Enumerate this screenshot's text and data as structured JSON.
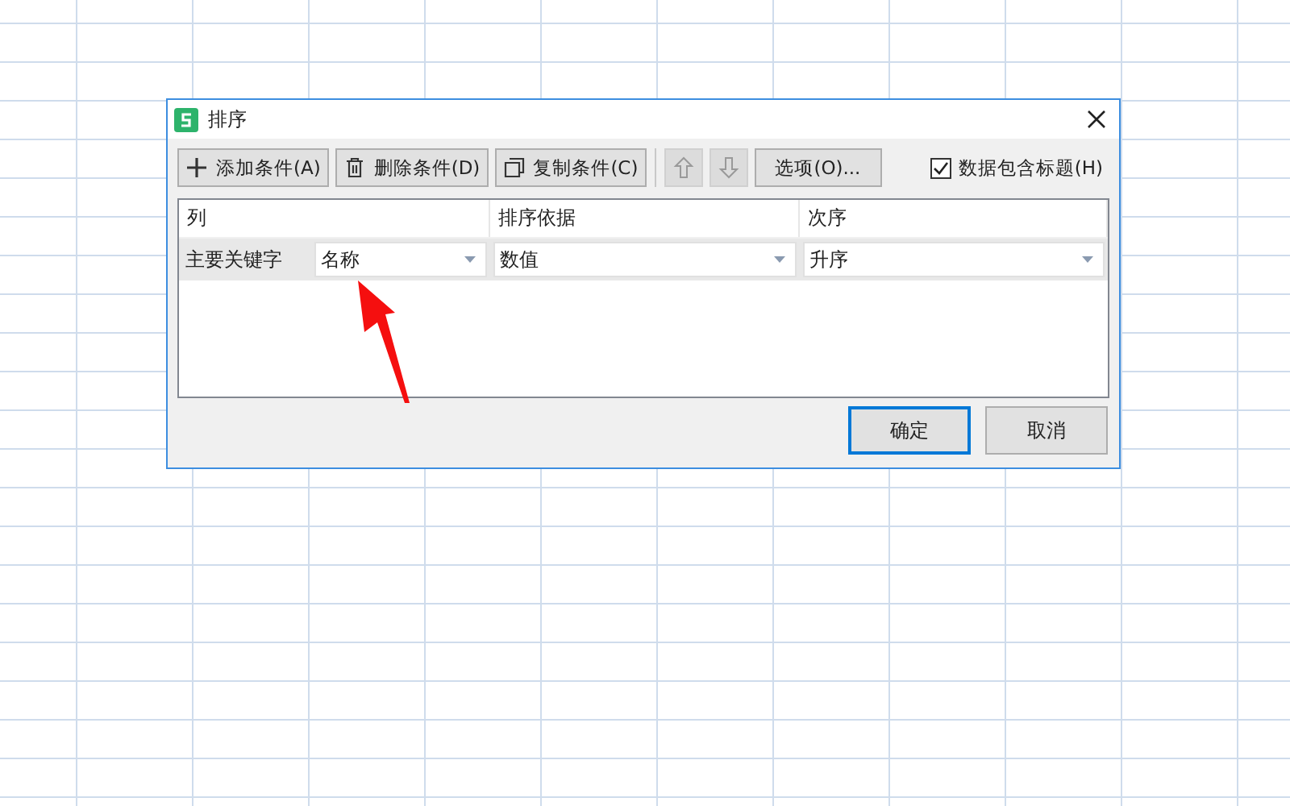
{
  "window": {
    "title": "排序"
  },
  "toolbar": {
    "buttons": [
      {
        "kind": "add",
        "label": "添加条件(A)",
        "disabled": false
      },
      {
        "kind": "delete",
        "label": "删除条件(D)",
        "disabled": false
      },
      {
        "kind": "copy",
        "label": "复制条件(C)",
        "disabled": false
      },
      {
        "kind": "up",
        "disabled": true
      },
      {
        "kind": "down",
        "disabled": true
      },
      {
        "kind": "text",
        "label": "选项(O)...",
        "disabled": false
      }
    ],
    "checkbox": {
      "label": "数据包含标题(H)",
      "checked": true
    }
  },
  "table": {
    "columns": [
      "列",
      "排序依据",
      "次序"
    ],
    "rows": [
      {
        "label": "主要关键字",
        "values": [
          "名称",
          "数值",
          "升序"
        ]
      }
    ]
  },
  "buttons": [
    {
      "label": "确定",
      "default": true
    },
    {
      "label": "取消",
      "default": false
    }
  ]
}
